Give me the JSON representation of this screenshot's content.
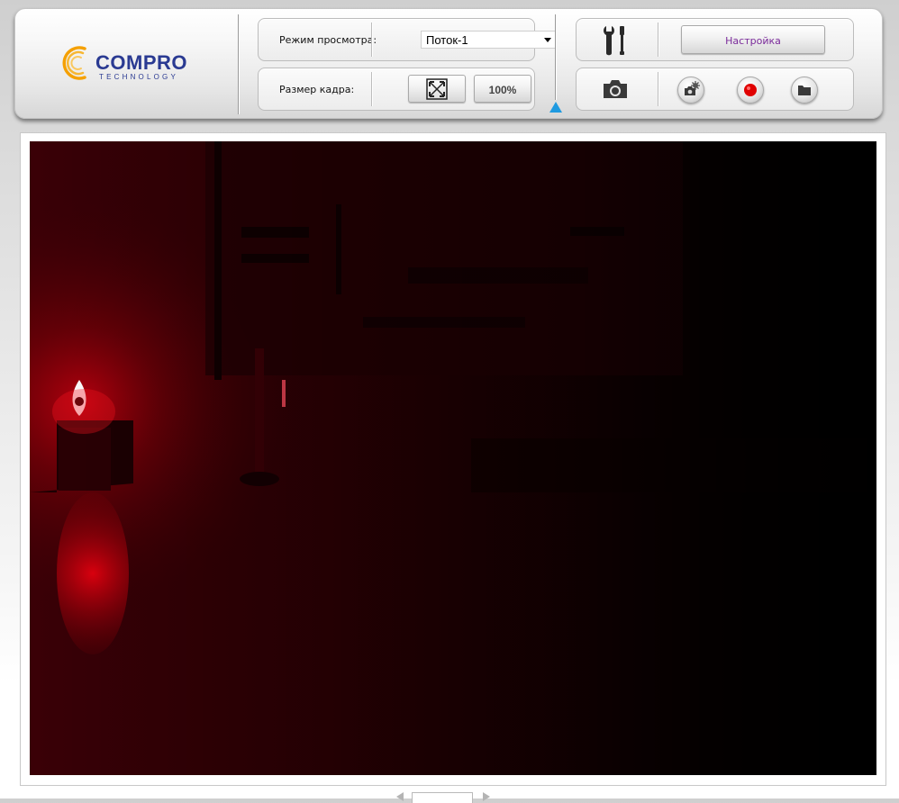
{
  "logo": {
    "brand": "COMPRO",
    "tagline": "TECHNOLOGY"
  },
  "view_panel": {
    "view_mode_label": "Режим просмотра:",
    "stream_selected": "Поток-1",
    "frame_size_label": "Размер кадра:",
    "fit_icon": "fit-to-window-icon",
    "zoom_button_label": "100%"
  },
  "control_panel": {
    "tools_icon": "wrench-screwdriver-icon",
    "setup_button_label": "Настройка",
    "snapshot_icon": "camera-icon",
    "snapshot_settings_icon": "camera-settings-icon",
    "record_icon": "record-icon",
    "folder_icon": "folder-icon"
  },
  "colors": {
    "accent_pointer": "#1f9ae0",
    "record_red": "#e00000",
    "logo_blue": "#2a3a92",
    "logo_orange": "#f5a000",
    "setup_text": "#7a2a9a"
  },
  "video": {
    "content": "live camera feed"
  }
}
